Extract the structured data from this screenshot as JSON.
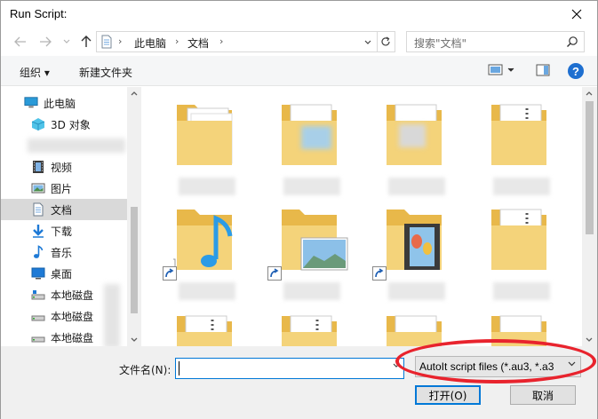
{
  "window": {
    "title": "Run Script:"
  },
  "address": {
    "crumbs": [
      "此电脑",
      "文档"
    ],
    "search_placeholder": "搜索\"文档\""
  },
  "commandbar": {
    "organize": "组织 ▾",
    "new_folder": "新建文件夹"
  },
  "sidebar": {
    "items": [
      {
        "label": "此电脑",
        "icon": "pc-icon"
      },
      {
        "label": "3D 对象",
        "icon": "3d-objects-icon"
      },
      {
        "label": "",
        "icon": "blurred-icon"
      },
      {
        "label": "视频",
        "icon": "video-icon"
      },
      {
        "label": "图片",
        "icon": "pictures-icon"
      },
      {
        "label": "文档",
        "icon": "documents-icon",
        "selected": true
      },
      {
        "label": "下载",
        "icon": "download-icon"
      },
      {
        "label": "音乐",
        "icon": "music-icon"
      },
      {
        "label": "桌面",
        "icon": "desktop-icon"
      },
      {
        "label": "本地磁盘",
        "icon": "drive-icon"
      },
      {
        "label": "本地磁盘",
        "icon": "drive-icon"
      },
      {
        "label": "本地磁盘",
        "icon": "drive-icon"
      }
    ]
  },
  "content": {
    "tiles": [
      {
        "type": "folder-docs"
      },
      {
        "type": "folder-docs"
      },
      {
        "type": "folder-docs"
      },
      {
        "type": "folder-docs"
      },
      {
        "type": "folder-music"
      },
      {
        "type": "folder-pictures"
      },
      {
        "type": "folder-video"
      },
      {
        "type": "folder-docs"
      },
      {
        "type": "folder-docs"
      },
      {
        "type": "folder-docs"
      },
      {
        "type": "folder-docs"
      },
      {
        "type": "folder-docs"
      }
    ]
  },
  "bottom": {
    "filename_label": "文件名(N):",
    "filename_value": "",
    "filter_label": "AutoIt script files (*.au3, *.a3",
    "open_label": "打开(O)",
    "cancel_label": "取消"
  },
  "colors": {
    "accent": "#0078d7",
    "highlight": "#e8232d",
    "folder": "#f4d37a"
  }
}
